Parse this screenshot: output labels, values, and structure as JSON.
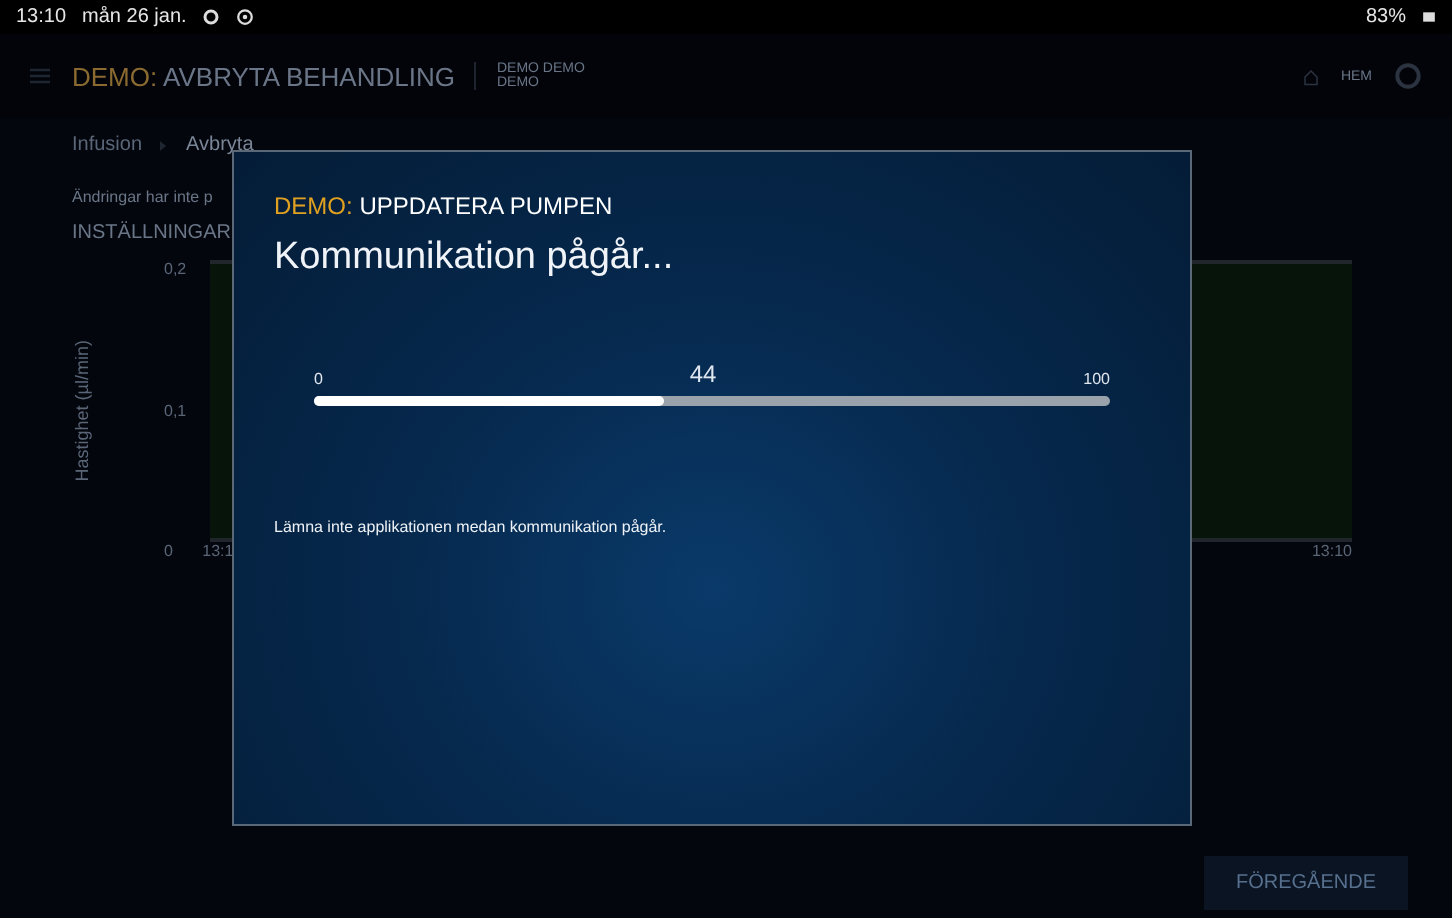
{
  "status_bar": {
    "time": "13:10",
    "date": "mån 26 jan.",
    "battery": "83%"
  },
  "header": {
    "prefix": "DEMO:",
    "title": "AVBRYTA BEHANDLING",
    "user": "DEMO DEMO",
    "role": "DEMO",
    "home": "HEM"
  },
  "breadcrumb": [
    {
      "label": "Infusion",
      "selected": false
    },
    {
      "label": "Avbryta",
      "selected": true
    }
  ],
  "notice": "Ändringar har inte p",
  "section_title": "INSTÄLLNINGAR",
  "chart": {
    "ylabel": "Hastighet (µl/min)",
    "yticks": [
      "0,2",
      "0,1",
      "0"
    ],
    "xlabels": [
      "13:1",
      "13:10"
    ]
  },
  "previous_button": "FÖREGÅENDE",
  "dialog": {
    "prefix": "DEMO:",
    "title": "UPPDATERA PUMPEN",
    "heading": "Kommunikation pågår...",
    "min": "0",
    "value": "44",
    "max": "100",
    "level": 0.44,
    "message": "Lämna inte applikationen medan kommunikation pågår."
  }
}
